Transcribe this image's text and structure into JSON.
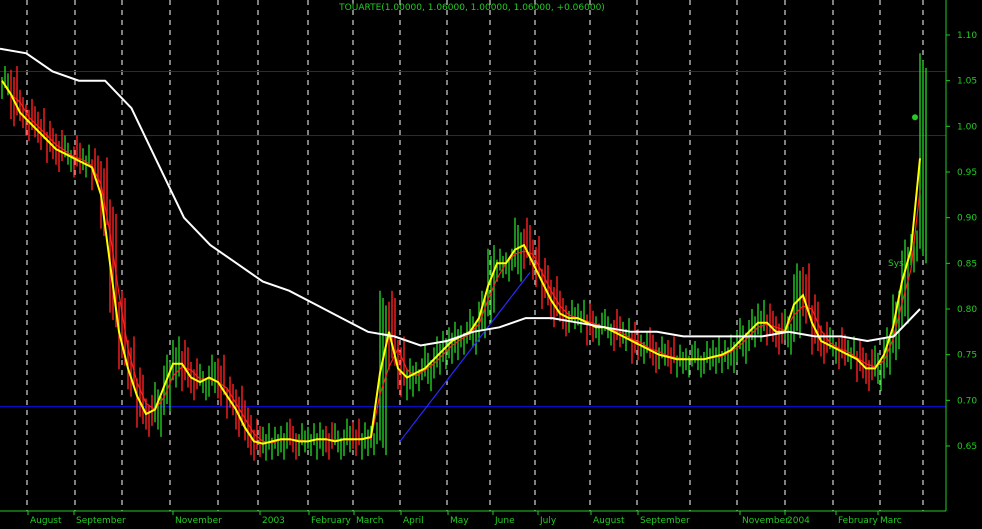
{
  "header": {
    "title": "TOUARTE(1.00000, 1.06000, 1.00000, 1.06000, +0.06000)"
  },
  "colors": {
    "background": "#000000",
    "grid": "#ffffff",
    "hline": "#1010ff",
    "trendline": "#2a2aff",
    "bar_up": "#22cc22",
    "bar_down": "#ff2020",
    "ma_fast": "#ffff00",
    "ma_mid": "#ff2020",
    "ma_slow": "#ffffff",
    "price_label": "#22cc22",
    "axis_text": "#22cc22"
  },
  "chart_data": {
    "type": "line",
    "title": "TOUARTE(1.00000, 1.06000, 1.00000, 1.06000, +0.06000)",
    "ylim": [
      0.6,
      1.12
    ],
    "y_ticks": [
      "0.65",
      "0.70",
      "0.75",
      "0.80",
      "0.85",
      "0.90",
      "0.95",
      "1.00",
      "1.05",
      "1.10"
    ],
    "horizontal_lines": [
      1.06,
      0.99,
      0.693
    ],
    "x_labels": [
      "August",
      "September",
      "November",
      "2003",
      "February",
      "March",
      "April",
      "May",
      "June",
      "July",
      "August",
      "September",
      "November",
      "2004",
      "February",
      "Marc"
    ],
    "grid": "vertical dashed",
    "annotations": [
      "Sys"
    ],
    "series": [
      {
        "role": "price-close",
        "values": [
          1.05,
          1.02,
          1.01,
          1.0,
          0.99,
          0.98,
          0.97,
          0.97,
          0.96,
          0.96,
          0.95,
          0.9,
          0.8,
          0.75,
          0.72,
          0.69,
          0.68,
          0.7,
          0.73,
          0.75,
          0.73,
          0.72,
          0.72,
          0.73,
          0.71,
          0.7,
          0.68,
          0.66,
          0.65,
          0.655,
          0.655,
          0.66,
          0.655,
          0.655,
          0.655,
          0.66,
          0.655,
          0.655,
          0.66,
          0.655,
          0.66,
          0.66,
          0.8,
          0.75,
          0.72,
          0.73,
          0.73,
          0.74,
          0.75,
          0.76,
          0.77,
          0.77,
          0.78,
          0.8,
          0.85,
          0.85,
          0.85,
          0.88,
          0.86,
          0.84,
          0.82,
          0.8,
          0.79,
          0.79,
          0.79,
          0.78,
          0.78,
          0.78,
          0.77,
          0.77,
          0.76,
          0.76,
          0.75,
          0.75,
          0.745,
          0.745,
          0.745,
          0.745,
          0.745,
          0.75,
          0.75,
          0.76,
          0.77,
          0.78,
          0.79,
          0.78,
          0.77,
          0.78,
          0.83,
          0.8,
          0.77,
          0.76,
          0.76,
          0.75,
          0.75,
          0.74,
          0.73,
          0.74,
          0.76,
          0.8,
          0.86,
          0.87,
          1.06
        ]
      },
      {
        "role": "ma-slow",
        "values": [
          1.085,
          1.08,
          1.06,
          1.05,
          1.05,
          1.02,
          0.96,
          0.9,
          0.87,
          0.85,
          0.83,
          0.82,
          0.805,
          0.79,
          0.775,
          0.77,
          0.76,
          0.765,
          0.775,
          0.78,
          0.79,
          0.79,
          0.785,
          0.78,
          0.775,
          0.775,
          0.77,
          0.77,
          0.77,
          0.77,
          0.775,
          0.77,
          0.77,
          0.765,
          0.77,
          0.8
        ]
      }
    ]
  }
}
